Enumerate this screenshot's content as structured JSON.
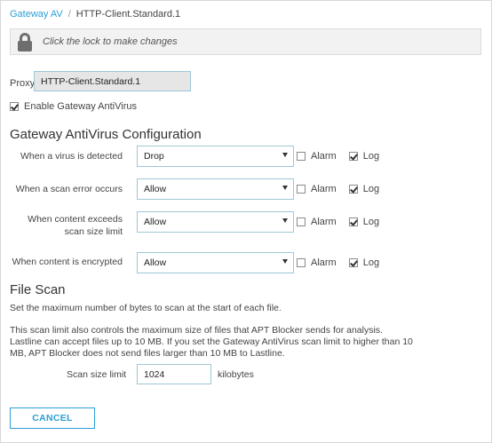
{
  "breadcrumb": {
    "parent": "Gateway AV",
    "separator": "/",
    "current": "HTTP-Client.Standard.1"
  },
  "lockbar": {
    "text": "Click the lock to make changes",
    "icon": "lock-icon"
  },
  "proxy": {
    "label": "Proxy",
    "value": "HTTP-Client.Standard.1"
  },
  "enable": {
    "label": "Enable Gateway AntiVirus",
    "checked": true
  },
  "config": {
    "title": "Gateway AntiVirus Configuration",
    "alarm_label": "Alarm",
    "log_label": "Log",
    "rows": [
      {
        "label": "When a virus is detected",
        "action": "Drop",
        "alarm": false,
        "log": true
      },
      {
        "label": "When a scan error occurs",
        "action": "Allow",
        "alarm": false,
        "log": true
      },
      {
        "label": "When content exceeds scan size limit",
        "action": "Allow",
        "alarm": false,
        "log": true
      },
      {
        "label": "When content is encrypted",
        "action": "Allow",
        "alarm": false,
        "log": true
      }
    ]
  },
  "file_scan": {
    "title": "File Scan",
    "description": "Set the maximum number of bytes to scan at the start of each file.",
    "note_line1": "This scan limit also controls the maximum size of files that APT Blocker sends for analysis.",
    "note_line2": "Lastline can accept files up to 10 MB. If you set the Gateway AntiVirus scan limit to higher than 10",
    "note_line3": "MB, APT Blocker does not send files larger than 10 MB to Lastline.",
    "size_label": "Scan size limit",
    "size_value": "1024",
    "size_unit": "kilobytes"
  },
  "buttons": {
    "cancel": "CANCEL"
  },
  "colors": {
    "accent": "#2a9fd6",
    "field_border": "#9ec7d6",
    "lockbar_bg": "#f2f2f2"
  }
}
